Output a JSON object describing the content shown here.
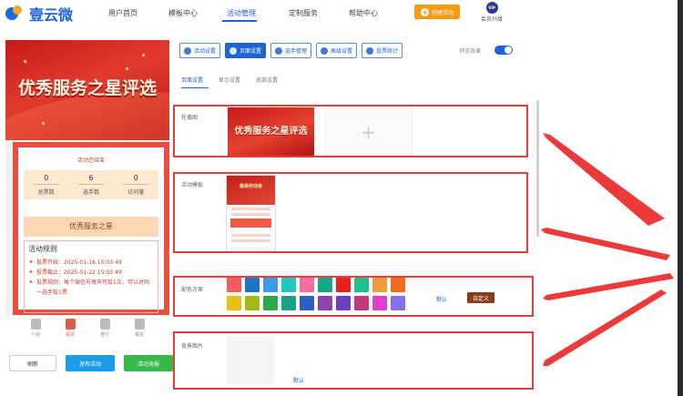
{
  "header": {
    "logo_text": "壹云微",
    "nav": [
      "用户首页",
      "模板中心",
      "活动管理",
      "定制服务",
      "帮助中心"
    ],
    "create_label": "创建活动",
    "vip_badge": "VIP",
    "vip_label": "会员升级"
  },
  "preview": {
    "banner_title": "优秀服务之星评选",
    "status": "活动已结束",
    "stats": [
      {
        "value": "0",
        "label": "总票数"
      },
      {
        "value": "6",
        "label": "选手数"
      },
      {
        "value": "0",
        "label": "访问量"
      }
    ],
    "star_title": "优秀服务之星",
    "rules_title": "活动规则",
    "rules": [
      "投票开始：2025-01-16 15:03:49",
      "投票截止：2025-01-22 15:03:49",
      "投票规则：每个微信号每天可投1次，可以对同一选手投1票"
    ],
    "tabs": [
      "介绍",
      "投票",
      "排行",
      "报名"
    ]
  },
  "actions": {
    "refresh": "刷新",
    "publish": "发布活动",
    "poster": "活动海报"
  },
  "toolbar": {
    "buttons": [
      "活动设置",
      "页面设置",
      "选手管理",
      "高级设置",
      "投票统计"
    ],
    "preview_label": "预览效果"
  },
  "subtabs": [
    "页面设置",
    "显示设置",
    "底部设置"
  ],
  "sections": {
    "carousel": "轮播图",
    "carousel_title": "优秀服务之星评选",
    "template": "活动模板",
    "template_title": "最美劳动者",
    "colors": "配色方案",
    "colors_default": "默认",
    "colors_custom": "自定义",
    "background": "背景图片",
    "background_default": "默认"
  },
  "palette": [
    "#f25c5c",
    "#1b74c4",
    "#3a9be8",
    "#20c8c0",
    "#f06ea0",
    "#17a589",
    "#e7211a",
    "#1dc28e",
    "#f39a3d",
    "#f36b1c",
    "#e9c012",
    "#a8b812",
    "#2ea84a",
    "#16a085",
    "#2d5fc4",
    "#8e44ad",
    "#6c3fc2",
    "#c0397a",
    "#e040c8",
    "#8a6de8"
  ]
}
